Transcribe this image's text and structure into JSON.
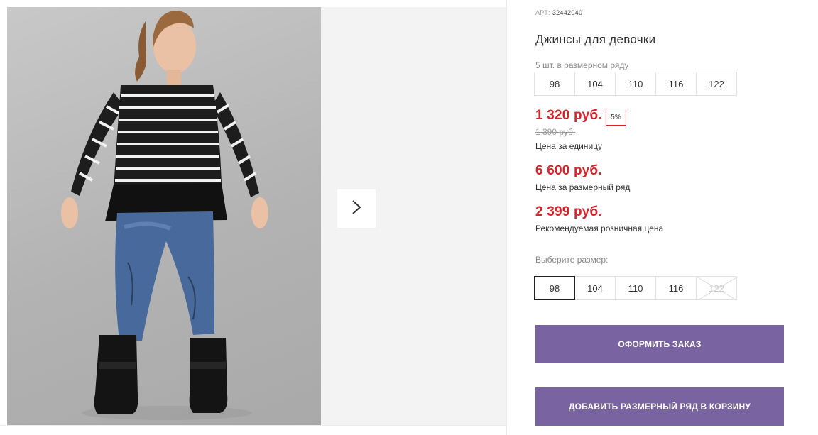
{
  "gallery": {
    "next_icon": "chevron-right-icon"
  },
  "product": {
    "art_label": "АРТ:",
    "art_value": "32442040",
    "title": "Джинсы для девочки",
    "size_row_label": "5 шт. в размерном ряду",
    "size_row": [
      "98",
      "104",
      "110",
      "116",
      "122"
    ],
    "unit_price": "1 320 руб.",
    "discount_badge": "5%",
    "old_price": "1 390 руб.",
    "unit_price_caption": "Цена за единицу",
    "row_price": "6 600 руб.",
    "row_price_caption": "Цена за размерный ряд",
    "retail_price": "2 399 руб.",
    "retail_price_caption": "Рекомендуемая розничная цена",
    "choose_size_label": "Выберите размер:",
    "sizes": [
      {
        "label": "98",
        "state": "selected"
      },
      {
        "label": "104",
        "state": "available"
      },
      {
        "label": "110",
        "state": "available"
      },
      {
        "label": "116",
        "state": "available"
      },
      {
        "label": "122",
        "state": "unavailable"
      }
    ],
    "order_button": "ОФОРМИТЬ ЗАКАЗ",
    "add_row_button": "ДОБАВИТЬ РАЗМЕРНЫЙ РЯД В КОРЗИНУ"
  },
  "colors": {
    "accent_price": "#d8232a",
    "button": "#7a63a1"
  }
}
